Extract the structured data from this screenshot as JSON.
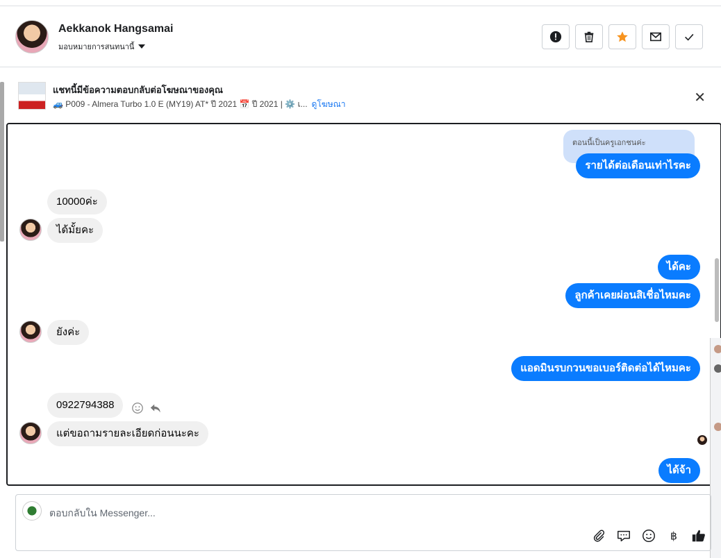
{
  "header": {
    "name": "Aekkanok Hangsamai",
    "assign_label": "มอบหมายการสนทนานี้",
    "actions": [
      "exclamation-icon",
      "trash-icon",
      "star-icon",
      "envelope-icon",
      "check-icon"
    ],
    "star_color": "#f7931e"
  },
  "ad": {
    "title": "แชทนี้มีข้อความตอบกลับต่อโฆษณาของคุณ",
    "subtitle": "🚙 P009 - Almera Turbo 1.0 E (MY19) AT* ปี 2021 📅 ปี 2021 | ⚙️ เ...",
    "link": "ดูโฆษณา"
  },
  "chat": {
    "reply_preview": "ตอนนี้เป็นครูเอกชนค่ะ",
    "messages": [
      {
        "side": "right",
        "text": "รายได้ต่อเดือนเท่าไรคะ"
      },
      {
        "side": "left",
        "text": "10000ค่ะ"
      },
      {
        "side": "left",
        "text": "ได้มั้ยคะ"
      },
      {
        "side": "right",
        "text": "ได้คะ"
      },
      {
        "side": "right",
        "text": "ลูกค้าเคยผ่อนสิเชื่อไหมคะ"
      },
      {
        "side": "left",
        "text": "ยังค่ะ"
      },
      {
        "side": "right",
        "text": "แอดมินรบกวนขอเบอร์ติดต่อได้ไหมคะ"
      },
      {
        "side": "left",
        "text": "0922794388"
      },
      {
        "side": "left",
        "text": "แต่ขอถามรายละเอียดก่อนนะคะ"
      },
      {
        "side": "right",
        "text": "ได้จ้า"
      }
    ],
    "accent": "#0a7cff"
  },
  "composer": {
    "placeholder": "ตอบกลับใน Messenger...",
    "tools": [
      "paperclip-icon",
      "chat-bubble-icon",
      "emoji-icon",
      "baht-icon",
      "thumbs-up-icon"
    ]
  }
}
